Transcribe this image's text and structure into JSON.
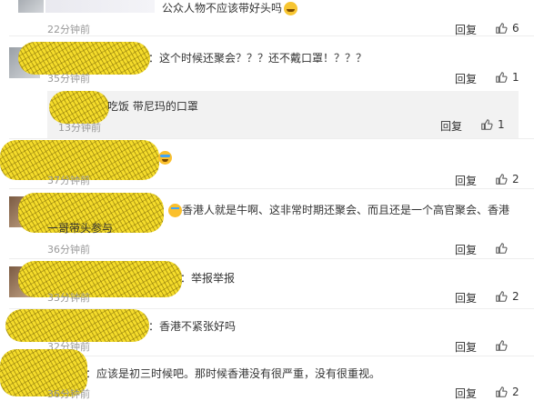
{
  "comments": [
    {
      "text": "公众人物不应该带好头吗",
      "emoji": "grin",
      "time": "22分钟前",
      "reply": "回复",
      "likes": "6"
    },
    {
      "text": "：这个时候还聚会？？？还不戴口罩！？？？",
      "time": "35分钟前",
      "reply": "回复",
      "likes": "1",
      "sub": {
        "text": "吃饭 带尼玛的口罩",
        "time": "13分钟前",
        "reply": "回复",
        "likes": "1"
      }
    },
    {
      "text": "",
      "emoji": "laugh",
      "time": "37分钟前",
      "reply": "回复",
      "likes": "2"
    },
    {
      "text": "香港人就是牛啊、这非常时期还聚会、而且还是一个高官聚会、香港",
      "text2": "一哥带头参与",
      "emoji": "pin",
      "time": "36分钟前",
      "reply": "回复",
      "likes": ""
    },
    {
      "text": "：举报举报",
      "time": "33分钟前",
      "reply": "回复",
      "likes": "2"
    },
    {
      "text": "：香港不紧张好吗",
      "time": "32分钟前",
      "reply": "回复",
      "likes": ""
    },
    {
      "text": "：应该是初三时候吧。那时候香港没有很严重，没有很重视。",
      "time": "36分钟前",
      "reply": "回复",
      "likes": "2"
    }
  ]
}
